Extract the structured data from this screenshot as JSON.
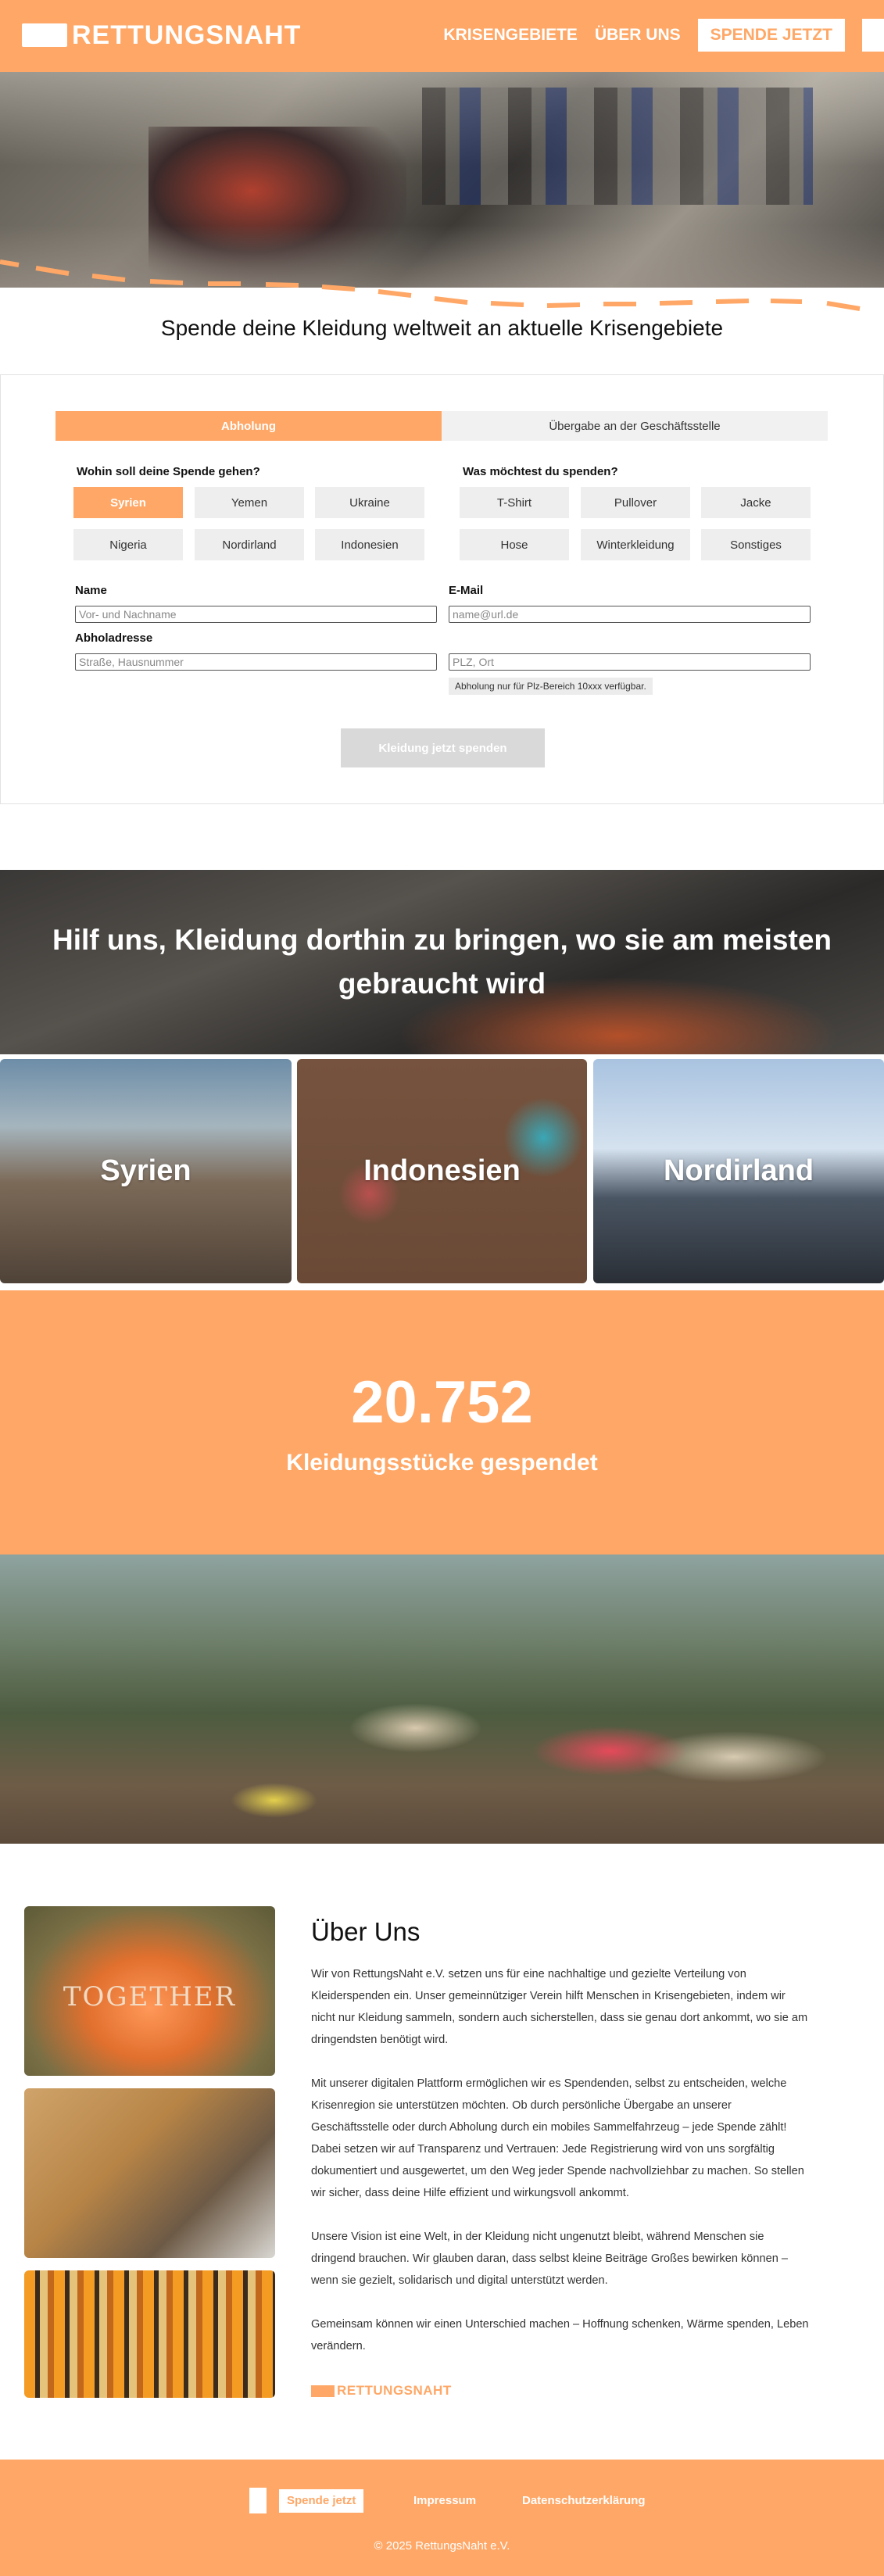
{
  "header": {
    "logo_text": "RETTUNGSNAHT",
    "nav": [
      "KRISENGEBIETE",
      "ÜBER UNS"
    ],
    "cta_label": "SPENDE JETZT"
  },
  "tagline": "Spende deine Kleidung weltweit an aktuelle Krisengebiete",
  "form": {
    "tabs": [
      {
        "label": "Abholung",
        "active": true
      },
      {
        "label": "Übergabe an der Geschäftsstelle",
        "active": false
      }
    ],
    "destination_question": "Wohin soll deine Spende gehen?",
    "destinations": [
      "Syrien",
      "Yemen",
      "Ukraine",
      "Nigeria",
      "Nordirland",
      "Indonesien"
    ],
    "selected_destination": "Syrien",
    "items_question": "Was möchtest du spenden?",
    "items": [
      "T-Shirt",
      "Pullover",
      "Jacke",
      "Hose",
      "Winterkleidung",
      "Sonstiges"
    ],
    "name_label": "Name",
    "name_placeholder": "Vor- und Nachname",
    "email_label": "E-Mail",
    "email_placeholder": "name@url.de",
    "address_label": "Abholadresse",
    "street_placeholder": "Straße, Hausnummer",
    "city_placeholder": "PLZ, Ort",
    "hint": "Abholung nur für Plz-Bereich 10xxx verfügbar.",
    "submit_label": "Kleidung jetzt spenden"
  },
  "banner": {
    "line1": "Hilf uns, Kleidung dorthin zu bringen, wo sie am meisten",
    "line2": "gebraucht wird"
  },
  "regions": [
    "Syrien",
    "Indonesien",
    "Nordirland"
  ],
  "stats": {
    "value": "20.752",
    "label": "Kleidungsstücke gespendet"
  },
  "about": {
    "image_text": "TOGETHER",
    "title": "Über Uns",
    "paragraphs": [
      {
        "lines": [
          "Wir von RettungsNaht e.V. setzen uns für eine nachhaltige und gezielte Verteilung von",
          "Kleiderspenden ein. Unser gemeinnütziger Verein hilft Menschen in Krisengebieten, indem wir",
          "nicht nur Kleidung sammeln, sondern auch sicherstellen, dass sie genau dort ankommt, wo sie am",
          "dringendsten benötigt wird."
        ]
      },
      {
        "lines": [
          "Mit unserer digitalen Plattform ermöglichen wir es Spendenden, selbst zu entscheiden, welche",
          "Krisenregion sie unterstützen möchten. Ob durch persönliche Übergabe an unserer",
          "Geschäftsstelle oder durch Abholung durch ein mobiles Sammelfahrzeug – jede Spende zählt!",
          "Dabei setzen wir auf Transparenz und Vertrauen: Jede Registrierung wird von uns sorgfältig",
          "dokumentiert und ausgewertet, um den Weg jeder Spende nachvollziehbar zu machen. So stellen",
          "wir sicher, dass deine Hilfe effizient und wirkungsvoll ankommt."
        ]
      },
      {
        "lines": [
          "Unsere Vision ist eine Welt, in der Kleidung nicht ungenutzt bleibt, während Menschen sie",
          "dringend brauchen. Wir glauben daran, dass selbst kleine Beiträge Großes bewirken können –",
          "wenn sie gezielt, solidarisch und digital unterstützt werden."
        ]
      },
      {
        "lines": [
          "Gemeinsam können wir einen Unterschied machen – Hoffnung schenken, Wärme spenden, Leben",
          "verändern."
        ]
      }
    ],
    "logo_text": "RETTUNGSNAHT"
  },
  "footer": {
    "cta_label": "Spende jetzt",
    "links": [
      "Impressum",
      "Datenschutzerklärung"
    ],
    "copyright": "© 2025 RettungsNaht e.V."
  },
  "colors": {
    "accent": "#ffa766",
    "chip": "#eeeeee",
    "disabled": "#d9d9d9"
  }
}
